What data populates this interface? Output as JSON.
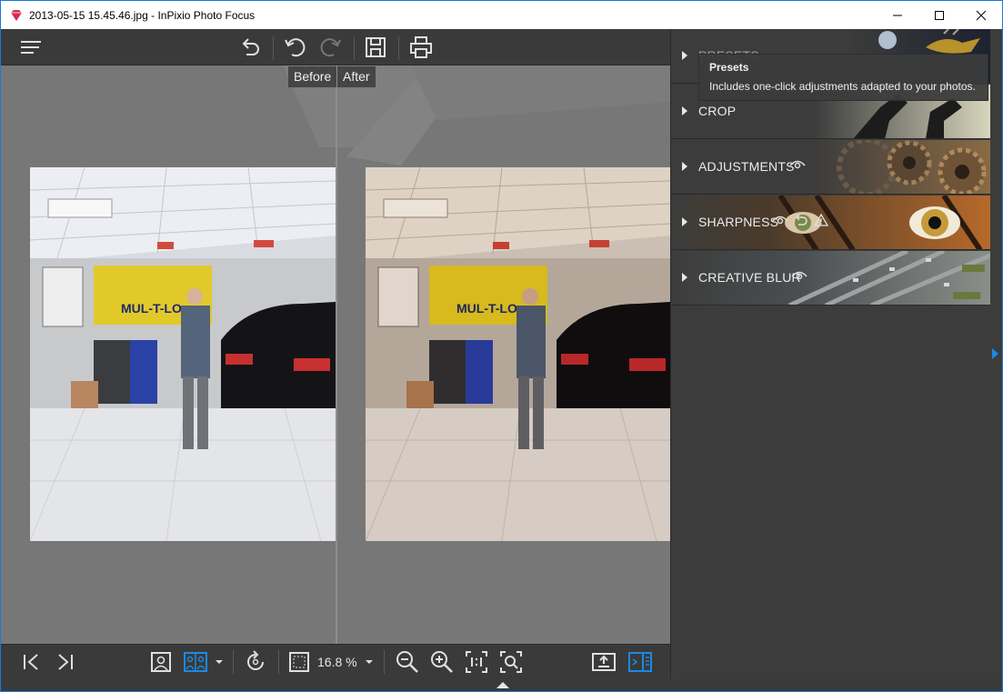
{
  "window": {
    "title": "2013-05-15 15.45.46.jpg - InPixio Photo Focus"
  },
  "toolbar": {
    "icons": [
      "menu-icon",
      "undo-all-icon",
      "undo-icon",
      "redo-icon",
      "save-icon",
      "print-icon"
    ]
  },
  "canvas": {
    "before_label": "Before",
    "after_label": "After"
  },
  "bottombar": {
    "zoom_value": "16.8 %",
    "icons": [
      "first-image-icon",
      "last-image-icon",
      "single-view-icon",
      "before-after-view-icon",
      "view-dropdown-icon",
      "rotate-icon",
      "fit-icon",
      "zoom-dropdown-icon",
      "zoom-out-icon",
      "zoom-in-icon",
      "actual-size-icon",
      "zoom-fit-icon",
      "export-icon",
      "side-panel-icon"
    ]
  },
  "panel": {
    "sections": [
      {
        "label": "PRESETS"
      },
      {
        "label": "CROP"
      },
      {
        "label": "ADJUSTMENTS"
      },
      {
        "label": "SHARPNESS"
      },
      {
        "label": "CREATIVE BLUR"
      }
    ],
    "tooltip": {
      "title": "Presets",
      "text": "Includes one-click adjustments adapted to your photos."
    }
  },
  "colors": {
    "accent": "#1a8ae6",
    "panel_bg": "#3c3c3c",
    "canvas_bg": "#777777"
  }
}
